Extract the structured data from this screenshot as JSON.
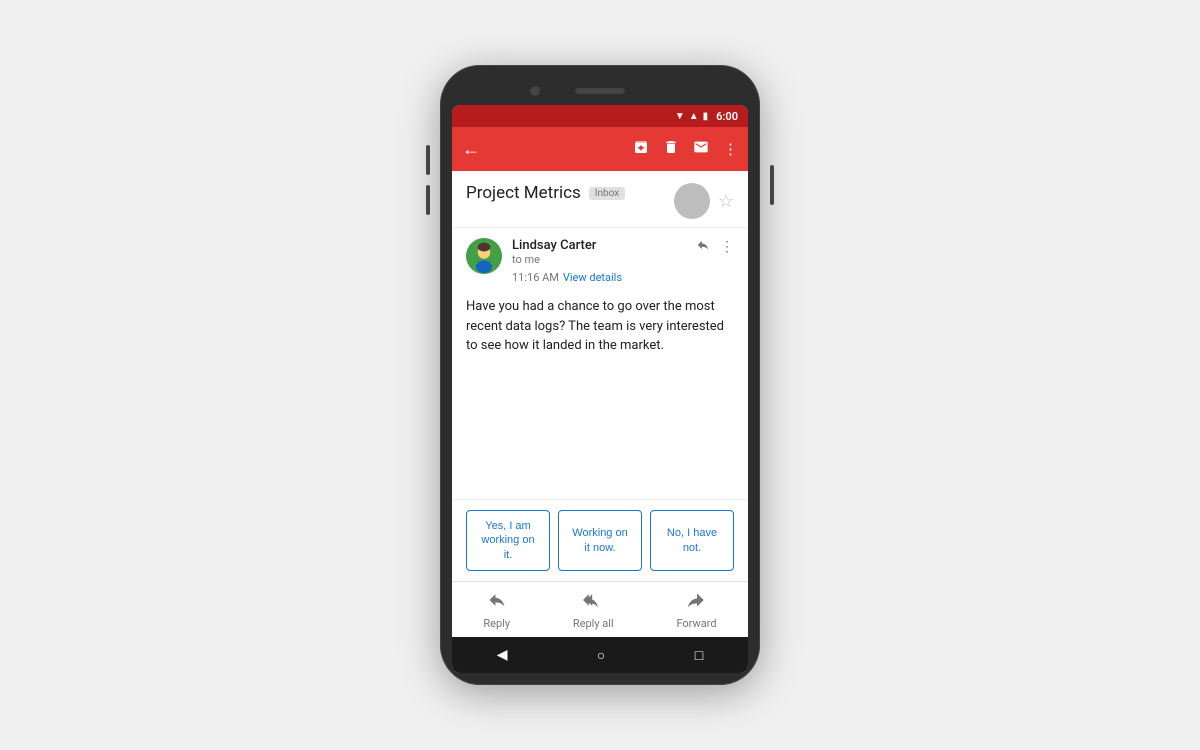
{
  "status_bar": {
    "time": "6:00"
  },
  "toolbar": {
    "back_icon": "←",
    "archive_icon": "⊡",
    "delete_icon": "🗑",
    "email_icon": "✉",
    "more_icon": "⋮"
  },
  "email_header": {
    "subject": "Project Metrics",
    "badge": "Inbox",
    "star_icon": "☆"
  },
  "sender": {
    "name": "Lindsay Carter",
    "to": "to me",
    "time": "11:16 AM",
    "view_details": "View details",
    "reply_icon": "↩",
    "more_icon": "⋮"
  },
  "email_body": {
    "text": "Have you had a chance to go over the most recent data logs? The team is very interested to see how it landed in the market."
  },
  "smart_replies": [
    {
      "label": "Yes, I am working on it."
    },
    {
      "label": "Working on it now."
    },
    {
      "label": "No, I have not."
    }
  ],
  "bottom_actions": [
    {
      "icon": "↩",
      "label": "Reply"
    },
    {
      "icon": "↩↩",
      "label": "Reply all"
    },
    {
      "icon": "→",
      "label": "Forward"
    }
  ],
  "android_nav": {
    "back": "◀",
    "home": "○",
    "recent": "□"
  }
}
